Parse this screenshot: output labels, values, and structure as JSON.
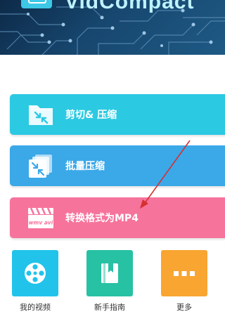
{
  "header": {
    "brand_text": "VidCompact"
  },
  "actions": {
    "cut_compress_label": "剪切& 压缩",
    "batch_compress_label": "批量压缩",
    "convert_mp4_label": "转换格式为MP4",
    "convert_icon_text": "wmv avi"
  },
  "bottom_nav": {
    "my_videos_label": "我的视频",
    "beginner_guide_label": "新手指南",
    "more_label": "更多"
  },
  "icons": {
    "cut_compress": "folder-compress-icon",
    "batch_compress": "stacked-compress-icon",
    "convert": "film-clapper-icon",
    "my_videos": "film-reel-icon",
    "guide": "book-icon",
    "more": "ellipsis-icon"
  },
  "colors": {
    "card_cut": "#2cc9e2",
    "card_batch": "#3ba8e8",
    "card_convert": "#f6739c",
    "tile_videos": "#21c3eb",
    "tile_guide": "#27c1a4",
    "tile_more": "#f9a531",
    "annotation_arrow": "#d63030"
  }
}
